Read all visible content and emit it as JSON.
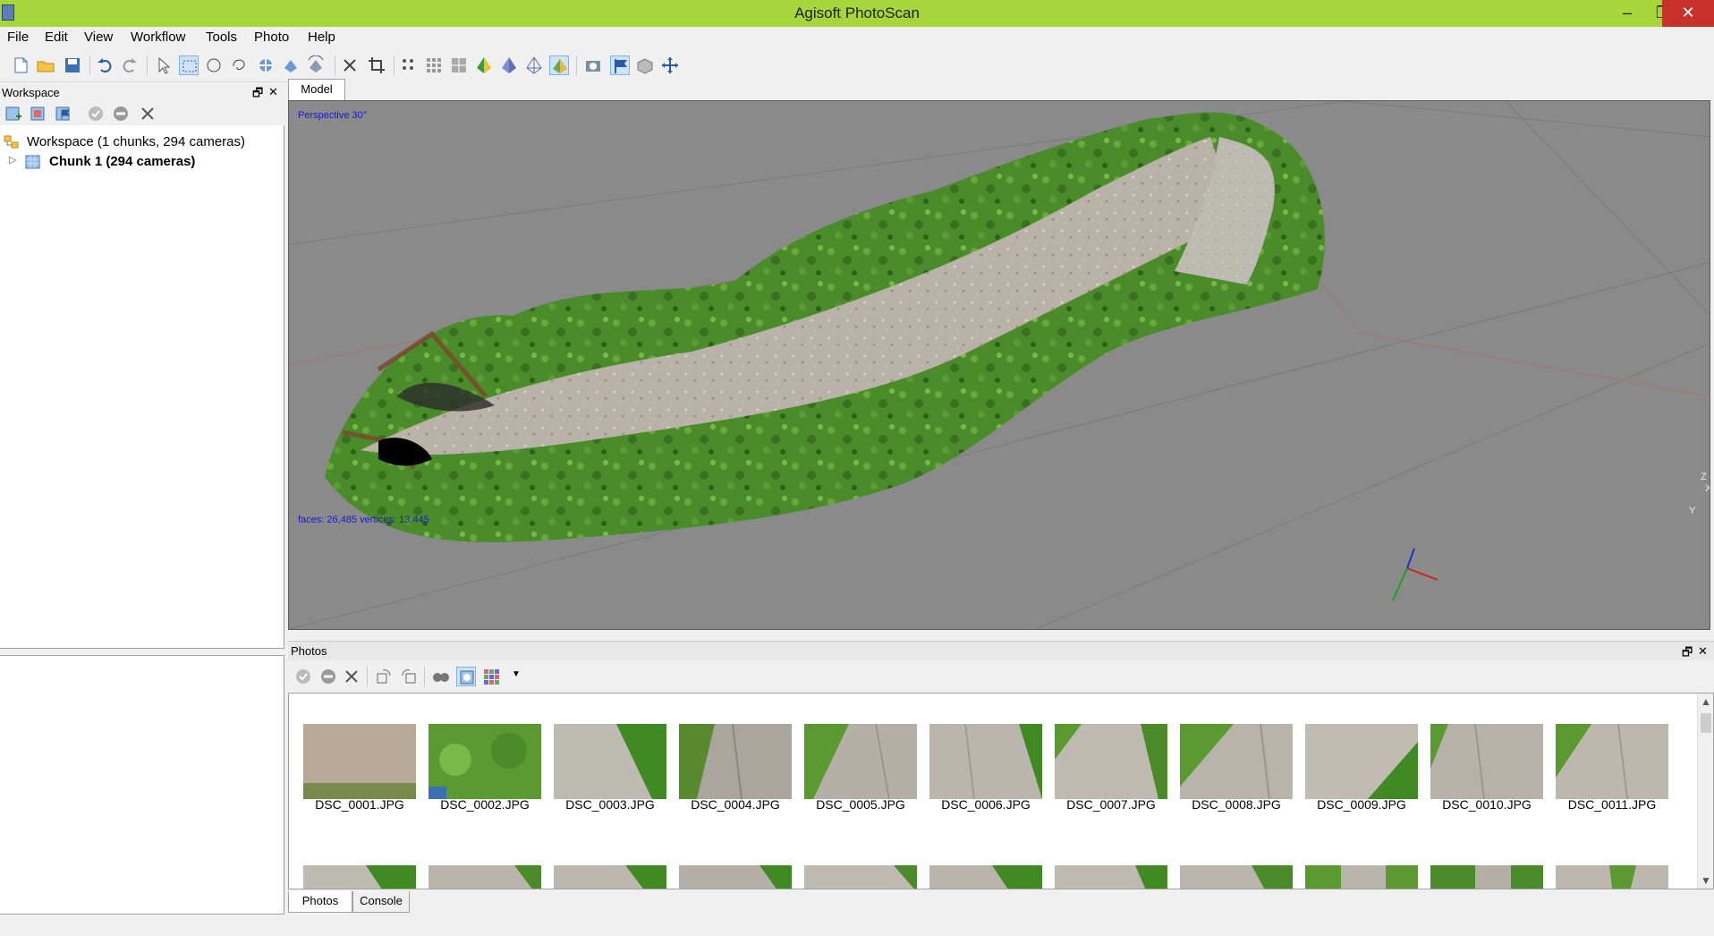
{
  "window": {
    "title": "Agisoft PhotoScan",
    "minimize": "–",
    "maximize": "❐",
    "close": "✕"
  },
  "menu": [
    "File",
    "Edit",
    "View",
    "Workflow",
    "Tools",
    "Photo",
    "Help"
  ],
  "workspace": {
    "title": "Workspace",
    "root_label": "Workspace (1 chunks, 294 cameras)",
    "chunk_label": "Chunk 1 (294 cameras)"
  },
  "model": {
    "tab_label": "Model",
    "projection": "Perspective 30°",
    "stats": "faces: 26,485 vertices: 13,445",
    "axis_labels": {
      "x": "X",
      "y": "Y",
      "z": "Z"
    }
  },
  "photos": {
    "title": "Photos",
    "items": [
      "DSC_0001.JPG",
      "DSC_0002.JPG",
      "DSC_0003.JPG",
      "DSC_0004.JPG",
      "DSC_0005.JPG",
      "DSC_0006.JPG",
      "DSC_0007.JPG",
      "DSC_0008.JPG",
      "DSC_0009.JPG",
      "DSC_0010.JPG",
      "DSC_0011.JPG"
    ]
  },
  "bottom_tabs": [
    "Photos",
    "Console"
  ],
  "colors": {
    "titlebar": "#a6d63c",
    "viewport": "#8a8a8a",
    "grass": "#4d8a2a",
    "path": "#b8b2a8",
    "close": "#c7312a"
  }
}
